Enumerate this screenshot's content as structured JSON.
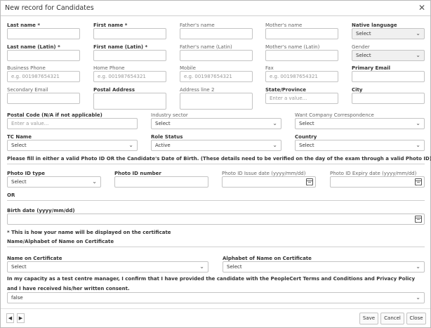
{
  "title": "New record for Candidates",
  "close_glyph": "✕",
  "labels": {
    "last_name": "Last name *",
    "first_name": "First name *",
    "fathers_name": "Father's name",
    "mothers_name": "Mother's name",
    "native_language": "Native language",
    "last_name_latin": "Last name (Latin) *",
    "first_name_latin": "First name (Latin) *",
    "fathers_name_latin": "Father's name (Latin)",
    "mothers_name_latin": "Mother's name (Latin)",
    "gender": "Gender",
    "business_phone": "Business Phone",
    "home_phone": "Home Phone",
    "mobile": "Mobile",
    "fax": "Fax",
    "primary_email": "Primary Email",
    "secondary_email": "Secondary Email",
    "postal_address": "Postal Address",
    "address_line_2": "Address line 2",
    "state_province": "State/Province",
    "city": "City",
    "postal_code": "Postal Code (N/A if not applicable)",
    "industry_sector": "Industry sector",
    "want_company_correspondence": "Want Company Correspondence",
    "tc_name": "TC Name",
    "role_status": "Role Status",
    "country": "Country",
    "photo_notice": "Please fill in either a valid Photo ID OR the Candidate's Date of Birth. (These details need to be verified on the day of the exam through a valid Photo ID)",
    "photo_id_type": "Photo ID type",
    "photo_id_number": "Photo ID number",
    "photo_id_issue_date": "Photo ID Issue date (yyyy/mm/dd)",
    "photo_id_expiry_date": "Photo ID Expiry date (yyyy/mm/dd)",
    "or": "OR",
    "birth_date": "Birth date (yyyy/mm/dd)",
    "certificate_note": "* This is how your name will be displayed on the certificate",
    "name_alphabet_heading": "Name/Alphabet of Name on Certificate",
    "name_on_certificate": "Name on Certificate",
    "alphabet_on_certificate": "Alphabet of Name on Certificate",
    "consent_line1": "In my capacity as a test centre manager, I confirm that I have provided the candidate with the PeopleCert Terms and Conditions and Privacy Policy",
    "consent_line2": "and I have received his/her written consent."
  },
  "placeholders": {
    "phone": "e.g. 001987654321",
    "enter_value": "Enter a value..."
  },
  "values": {
    "select": "Select",
    "active": "Active",
    "consent": "false"
  },
  "icons": {
    "chevron": "⌄",
    "calendar": "calendar-icon"
  },
  "nav": {
    "prev": "◀",
    "next": "▶"
  },
  "buttons": {
    "save": "Save",
    "cancel": "Cancel",
    "close": "Close"
  }
}
